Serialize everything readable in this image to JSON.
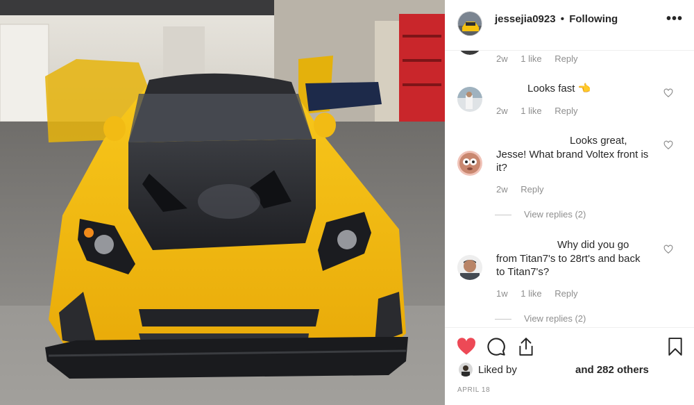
{
  "post": {
    "username": "jessejia0923",
    "separator": "•",
    "follow_status": "Following",
    "more_glyph": "•••"
  },
  "comments": [
    {
      "text": "",
      "time": "2w",
      "likes": "1 like",
      "reply": "Reply"
    },
    {
      "text": "Looks fast 👈",
      "time": "2w",
      "likes": "1 like",
      "reply": "Reply"
    },
    {
      "text": "Looks great, Jesse! What brand Voltex front is it?",
      "text_line1": "Looks great,",
      "text_line2": "Jesse! What brand Voltex front is",
      "text_line3": "it?",
      "time": "2w",
      "reply": "Reply",
      "view_replies": "View replies (2)"
    },
    {
      "text_line1": "Why did you go",
      "text_line2": "from Titan7's to 28rt's and back",
      "text_line3": "to Titan7's?",
      "time": "1w",
      "likes": "1 like",
      "reply": "Reply",
      "view_replies": "View replies (2)"
    }
  ],
  "footer": {
    "liked_by": "Liked by",
    "others": "and 282 others",
    "date": "APRIL 18"
  },
  "icons": {
    "like": "heart-filled-icon",
    "comment": "comment-bubble-icon",
    "share": "share-upload-icon",
    "save": "bookmark-icon",
    "comment_like": "heart-outline-icon",
    "more": "more-options-icon"
  },
  "colors": {
    "like_red": "#ed4956",
    "text": "#262626",
    "meta": "#8e8e8e",
    "car_yellow": "#f5c10e"
  }
}
